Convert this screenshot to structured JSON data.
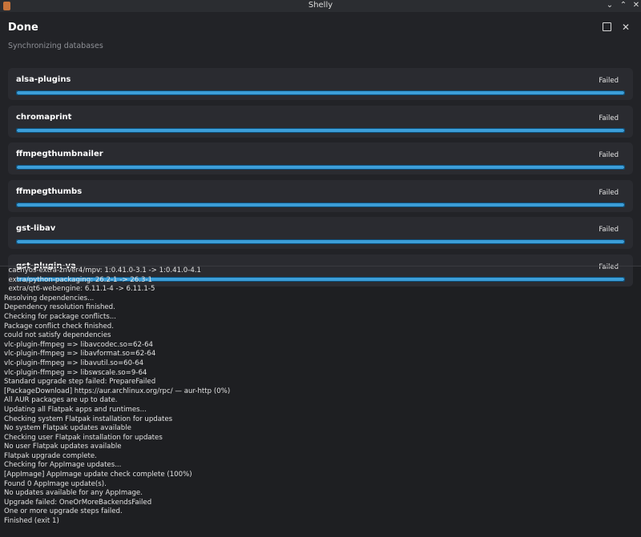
{
  "window": {
    "title": "Shelly"
  },
  "header": {
    "title": "Done",
    "subtitle": "Synchronizing databases"
  },
  "packages": [
    {
      "name": "alsa-plugins",
      "status": "Failed",
      "progress": 1.0
    },
    {
      "name": "chromaprint",
      "status": "Failed",
      "progress": 1.0
    },
    {
      "name": "ffmpegthumbnailer",
      "status": "Failed",
      "progress": 1.0
    },
    {
      "name": "ffmpegthumbs",
      "status": "Failed",
      "progress": 1.0
    },
    {
      "name": "gst-libav",
      "status": "Failed",
      "progress": 1.0
    },
    {
      "name": "gst-plugin-va",
      "status": "Failed",
      "progress": 1.0
    }
  ],
  "log": [
    "  cachyos-extra-znver4/mpv: 1:0.41.0-3.1 -> 1:0.41.0-4.1",
    "  extra/python-packaging: 26.2-1 -> 26.3-1",
    "  extra/qt6-webengine: 6.11.1-4 -> 6.11.1-5",
    "Resolving dependencies...",
    "Dependency resolution finished.",
    "Checking for package conflicts...",
    "Package conflict check finished.",
    "could not satisfy dependencies",
    "vlc-plugin-ffmpeg => libavcodec.so=62-64",
    "vlc-plugin-ffmpeg => libavformat.so=62-64",
    "vlc-plugin-ffmpeg => libavutil.so=60-64",
    "vlc-plugin-ffmpeg => libswscale.so=9-64",
    "Standard upgrade step failed: PrepareFailed",
    "[PackageDownload] https://aur.archlinux.org/rpc/ — aur-http (0%)",
    "All AUR packages are up to date.",
    "Updating all Flatpak apps and runtimes...",
    "Checking system Flatpak installation for updates",
    "No system Flatpak updates available",
    "Checking user Flatpak installation for updates",
    "No user Flatpak updates available",
    "Flatpak upgrade complete.",
    "Checking for AppImage updates...",
    "[AppImage] AppImage update check complete (100%)",
    "Found 0 AppImage update(s).",
    "No updates available for any AppImage.",
    "Upgrade failed: OneOrMoreBackendsFailed",
    "One or more upgrade steps failed.",
    "Finished (exit 1)"
  ]
}
